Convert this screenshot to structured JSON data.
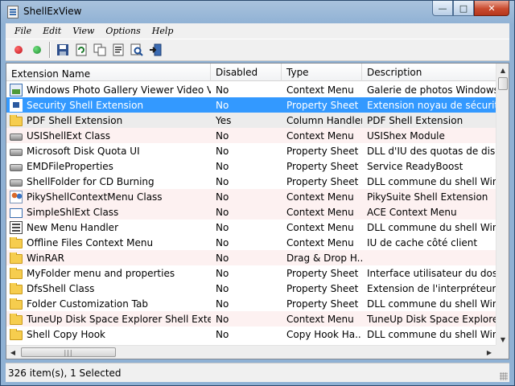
{
  "window": {
    "title": "ShellExView"
  },
  "caption": {
    "minimize": "—",
    "maximize": "□",
    "close": "✕"
  },
  "menu": [
    "File",
    "Edit",
    "View",
    "Options",
    "Help"
  ],
  "toolbar": {
    "buttons": [
      {
        "icon": "disable-red-icon",
        "color": "#c0141e"
      },
      {
        "icon": "enable-green-icon",
        "color": "#1e8a2e"
      },
      {
        "icon": "save-icon"
      },
      {
        "icon": "refresh-icon"
      },
      {
        "icon": "copy-icon"
      },
      {
        "icon": "properties-icon"
      },
      {
        "icon": "find-icon"
      },
      {
        "icon": "exit-icon"
      }
    ]
  },
  "columns": [
    "Extension Name",
    "Disabled",
    "Type",
    "Description"
  ],
  "rows": [
    {
      "icon": "photo",
      "name": "Windows Photo Gallery Viewer Video Verbs",
      "disabled": "No",
      "type": "Context Menu",
      "description": "Galerie de photos Windows",
      "style": ""
    },
    {
      "icon": "sel-page",
      "name": "Security Shell Extension",
      "disabled": "No",
      "type": "Property Sheet",
      "description": "Extension noyau de sécurité",
      "style": "selected"
    },
    {
      "icon": "folder",
      "name": "PDF Shell Extension",
      "disabled": "Yes",
      "type": "Column Handler",
      "description": "PDF Shell Extension",
      "style": "gray"
    },
    {
      "icon": "drive",
      "name": "USIShellExt Class",
      "disabled": "No",
      "type": "Context Menu",
      "description": "USIShex Module",
      "style": "pink"
    },
    {
      "icon": "drive",
      "name": "Microsoft Disk Quota UI",
      "disabled": "No",
      "type": "Property Sheet",
      "description": "DLL d'IU des quotas de disque",
      "style": ""
    },
    {
      "icon": "drive",
      "name": "EMDFileProperties",
      "disabled": "No",
      "type": "Property Sheet",
      "description": "Service ReadyBoost",
      "style": ""
    },
    {
      "icon": "drive",
      "name": "ShellFolder for CD Burning",
      "disabled": "No",
      "type": "Property Sheet",
      "description": "DLL commune du shell Windo",
      "style": ""
    },
    {
      "icon": "people",
      "name": "PikyShellContextMenu Class",
      "disabled": "No",
      "type": "Context Menu",
      "description": "PikySuite Shell Extension",
      "style": "pink"
    },
    {
      "icon": "blank",
      "name": "SimpleShlExt Class",
      "disabled": "No",
      "type": "Context Menu",
      "description": "ACE Context Menu",
      "style": "pink"
    },
    {
      "icon": "menu",
      "name": "New Menu Handler",
      "disabled": "No",
      "type": "Context Menu",
      "description": "DLL commune du shell Windo",
      "style": ""
    },
    {
      "icon": "folder",
      "name": "Offline Files Context Menu",
      "disabled": "No",
      "type": "Context Menu",
      "description": "IU de cache côté client",
      "style": ""
    },
    {
      "icon": "folder",
      "name": "WinRAR",
      "disabled": "No",
      "type": "Drag & Drop H...",
      "description": "",
      "style": "pink"
    },
    {
      "icon": "folder",
      "name": "MyFolder menu and properties",
      "disabled": "No",
      "type": "Property Sheet",
      "description": "Interface utilisateur du dossier",
      "style": ""
    },
    {
      "icon": "folder",
      "name": "DfsShell Class",
      "disabled": "No",
      "type": "Property Sheet",
      "description": "Extension de l'interpréteur de c",
      "style": ""
    },
    {
      "icon": "folder",
      "name": "Folder Customization Tab",
      "disabled": "No",
      "type": "Property Sheet",
      "description": "DLL commune du shell Windo",
      "style": ""
    },
    {
      "icon": "folder",
      "name": "TuneUp Disk Space Explorer Shell Extension",
      "disabled": "No",
      "type": "Context Menu",
      "description": "TuneUp Disk Space Explorer Sh",
      "style": "pink"
    },
    {
      "icon": "folder",
      "name": "Shell Copy Hook",
      "disabled": "No",
      "type": "Copy Hook Ha...",
      "description": "DLL commune du shell Windo",
      "style": ""
    }
  ],
  "status": {
    "text": "326 item(s), 1 Selected"
  }
}
